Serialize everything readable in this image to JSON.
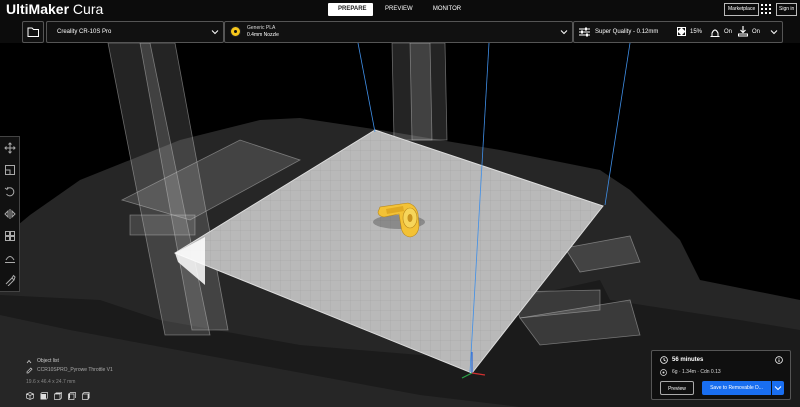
{
  "header": {
    "logo_bold": "UltiMaker",
    "logo_light": " Cura",
    "tabs": [
      "PREPARE",
      "PREVIEW",
      "MONITOR"
    ],
    "active_tab": "PREPARE",
    "marketplace": "Marketplace",
    "signin": "Sign in"
  },
  "toolbar": {
    "printer": "Creality CR-10S Pro",
    "material": "Generic PLA",
    "nozzle": "0.4mm Nozzle",
    "profile": "Super Quality - 0.12mm",
    "infill": "15%",
    "support": "On",
    "adhesion": "On"
  },
  "object_list": {
    "header": "Object list",
    "name": "CCR10SPRO_Pyrowe Throttle V1",
    "dimensions": "19.6 x 46.4 x 24.7 mm"
  },
  "print_panel": {
    "time": "56 minutes",
    "usage": "6g · 1.34m · Cdn 0.13",
    "preview_button": "Preview",
    "save_button": "Save to Removable D..."
  },
  "colors": {
    "accent_blue": "#196ef0",
    "material_yellow": "#f5c61b",
    "bed_grey": "#b9b9b9"
  },
  "icons": {
    "open": "folder-icon",
    "apps": "apps-grid-icon",
    "settings": "sliders-icon",
    "infill": "infill-icon",
    "support": "support-icon",
    "adhesion": "adhesion-icon",
    "time": "clock-icon",
    "info": "info-icon"
  }
}
